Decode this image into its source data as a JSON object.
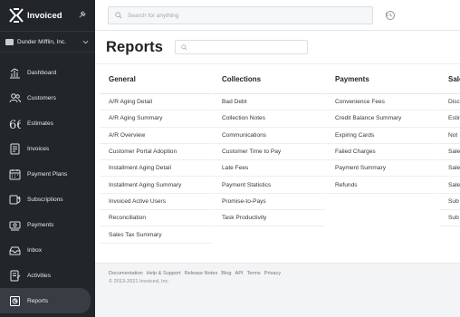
{
  "brand": {
    "name": "Invoiced"
  },
  "account": {
    "name": "Dunder Mifflin, Inc."
  },
  "nav": {
    "items": [
      {
        "label": "Dashboard",
        "icon": "dashboard-chart-icon"
      },
      {
        "label": "Customers",
        "icon": "users-icon"
      },
      {
        "label": "Estimates",
        "icon": "quote-icon"
      },
      {
        "label": "Invoices",
        "icon": "invoice-icon"
      },
      {
        "label": "Payment Plans",
        "icon": "calendar-icon"
      },
      {
        "label": "Subscriptions",
        "icon": "subscriptions-icon"
      },
      {
        "label": "Payments",
        "icon": "payments-icon"
      },
      {
        "label": "Inbox",
        "icon": "inbox-icon"
      },
      {
        "label": "Activities",
        "icon": "activities-icon"
      },
      {
        "label": "Reports",
        "icon": "reports-icon",
        "active": true
      }
    ]
  },
  "search": {
    "placeholder": "Search for anything"
  },
  "page": {
    "title": "Reports"
  },
  "columns": [
    {
      "title": "General",
      "items": [
        "A/R Aging Detail",
        "A/R Aging Summary",
        "A/R Overview",
        "Customer Portal Adoption",
        "Installment Aging Detail",
        "Installment Aging Summary",
        "Invoiced Active Users",
        "Reconciliation",
        "Sales Tax Summary"
      ]
    },
    {
      "title": "Collections",
      "items": [
        "Bad Debt",
        "Collection Notes",
        "Communications",
        "Customer Time to Pay",
        "Late Fees",
        "Payment Statistics",
        "Promise-to-Pays",
        "Task Productivity"
      ]
    },
    {
      "title": "Payments",
      "items": [
        "Convenience Fees",
        "Credit Balance Summary",
        "Expiring Cards",
        "Failed Charges",
        "Payment Summary",
        "Refunds"
      ]
    },
    {
      "title": "Sale",
      "items": [
        "Disco",
        "Estim",
        "Not",
        "Sale",
        "Sale",
        "Sale",
        "Sub",
        "Sub"
      ]
    }
  ],
  "footer": {
    "links": [
      "Documentation",
      "Help & Support",
      "Release Notes",
      "Blog",
      "API",
      "Terms",
      "Privacy"
    ],
    "copyright": "© 2013-2021 Invoiced, Inc."
  },
  "colors": {
    "sidebar": "#22262b",
    "active_item": "#383d44",
    "text": "#1d2125"
  }
}
